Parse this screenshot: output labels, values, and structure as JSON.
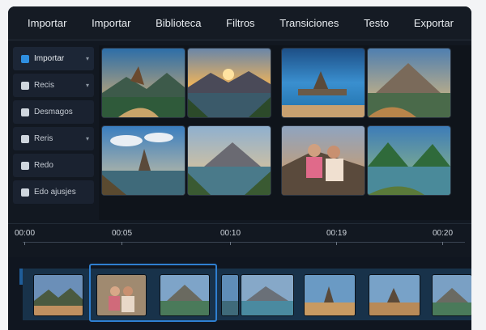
{
  "menu": [
    "Importar",
    "Importar",
    "Biblioteca",
    "Filtros",
    "Transiciones",
    "Testo",
    "Exportar"
  ],
  "sidebar": {
    "items": [
      {
        "label": "Importar",
        "icon": "import-icon",
        "chevron": "▾"
      },
      {
        "label": "Recis",
        "icon": "square-icon",
        "chevron": "▾"
      },
      {
        "label": "Desmagos",
        "icon": "square-icon",
        "chevron": ""
      },
      {
        "label": "Reris",
        "icon": "square-icon",
        "chevron": "▾"
      },
      {
        "label": "Redo",
        "icon": "square-icon",
        "chevron": ""
      },
      {
        "label": "Edo ajusjes",
        "icon": "square-icon",
        "chevron": ""
      }
    ]
  },
  "timeline": {
    "ticks": [
      "00:00",
      "00:05",
      "00:10",
      "00:19",
      "00:20"
    ]
  },
  "colors": {
    "accent": "#2f7fd0",
    "app_bg": "#121821",
    "menu_bg": "#151b24"
  }
}
